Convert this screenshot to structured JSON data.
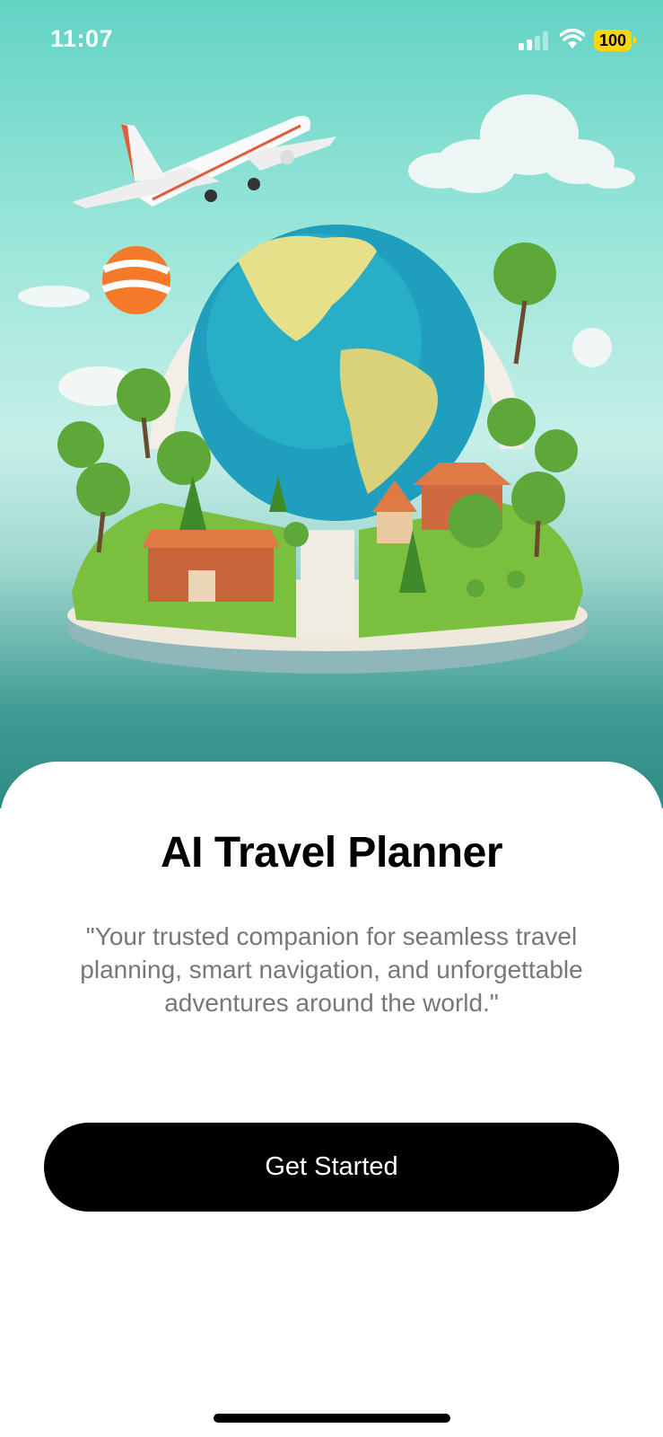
{
  "status_bar": {
    "time": "11:07",
    "battery_level": "100",
    "icons": [
      "cellular-signal-icon",
      "wifi-icon",
      "battery-icon"
    ]
  },
  "hero": {
    "illustration": "globe-with-village-airplane-clouds"
  },
  "content": {
    "title": "AI Travel Planner",
    "subtitle": "\"Your trusted companion for seamless travel planning, smart navigation, and unforgettable adventures around the world.\"",
    "cta_label": "Get Started"
  },
  "colors": {
    "accent": "#000000",
    "hero_teal": "#62d3c4",
    "battery": "#ffd60a",
    "subtitle_text": "#777777"
  }
}
